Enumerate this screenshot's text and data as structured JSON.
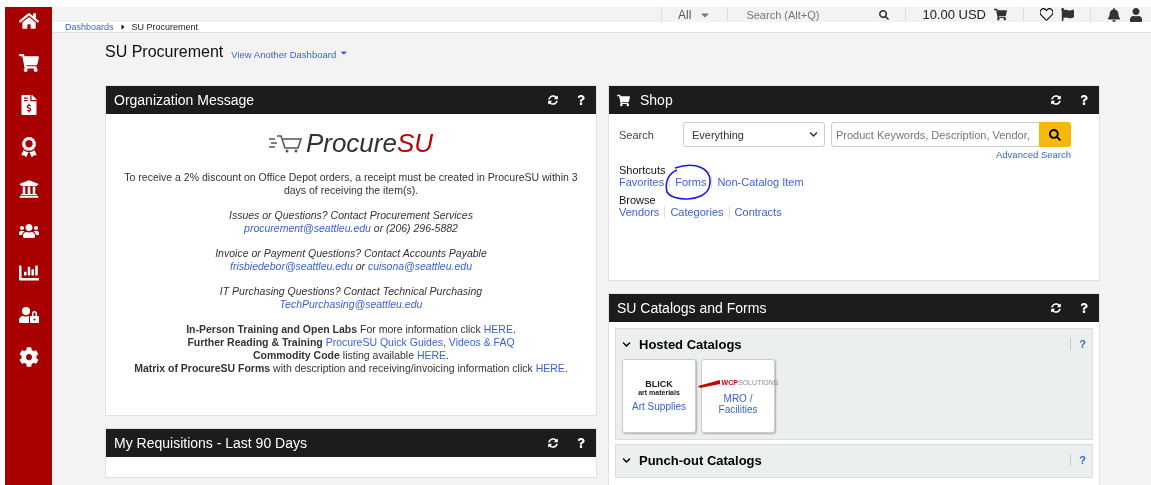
{
  "top_bar": {
    "scope": "All",
    "search_placeholder": "Search (Alt+Q)",
    "cart_total": "10.00 USD"
  },
  "sidebar": {
    "items": [
      {
        "kind": "home"
      },
      {
        "kind": "cart"
      },
      {
        "kind": "orders"
      },
      {
        "kind": "award"
      },
      {
        "kind": "bank"
      },
      {
        "kind": "users"
      },
      {
        "kind": "chart"
      },
      {
        "kind": "lock"
      },
      {
        "kind": "settings"
      }
    ]
  },
  "breadcrumb": [
    "Dashboards",
    "SU Procurement"
  ],
  "page": {
    "title": "SU Procurement",
    "switcher": "View Another Dashboard"
  },
  "organization_message": {
    "title": "Organization Message",
    "logo": {
      "main": "Procure",
      "accent": "SU"
    },
    "paragraphs": [
      [
        [
          {
            "kind": "plain",
            "text": "To receive a 2% discount on Office Depot orders, a receipt must be created in ProcureSU within 3 days of receiving the item(s)."
          }
        ]
      ],
      [
        [
          {
            "kind": "italic",
            "text": "Issues or Questions? Contact Procurement Services"
          }
        ],
        [
          {
            "kind": "link",
            "text": "procurement@seattleu.edu"
          },
          {
            "kind": "note",
            "text": " or (206) 296-5882"
          }
        ]
      ],
      [
        [
          {
            "kind": "italic",
            "text": "Invoice or Payment Questions? Contact Accounts Payable"
          }
        ],
        [
          {
            "kind": "link",
            "text": "frisbiedebor@seattleu.edu"
          },
          {
            "kind": "note",
            "text": " or "
          },
          {
            "kind": "link",
            "text": "cuisona@seattleu.edu"
          }
        ]
      ],
      [
        [
          {
            "kind": "italic",
            "text": "IT Purchasing Questions? Contact Technical Purchasing"
          }
        ],
        [
          {
            "kind": "link",
            "text": "TechPurchasing@seattleu.edu"
          }
        ]
      ],
      [
        [
          {
            "kind": "bold",
            "text": "In-Person Training and Open Labs"
          },
          {
            "kind": "plain",
            "text": " For more information click "
          },
          {
            "kind": "link",
            "text": "HERE"
          },
          {
            "kind": "plain",
            "text": "."
          }
        ],
        [
          {
            "kind": "bold",
            "text": "Further Reading & Training "
          },
          {
            "kind": "link",
            "text": "ProcureSU Quick Guides, Videos & FAQ"
          }
        ],
        [
          {
            "kind": "bold",
            "text": "Commodity Code"
          },
          {
            "kind": "plain",
            "text": " listing available "
          },
          {
            "kind": "link",
            "text": "HERE"
          },
          {
            "kind": "plain",
            "text": "."
          }
        ],
        [
          {
            "kind": "bold",
            "text": "Matrix of ProcureSU Forms"
          },
          {
            "kind": "plain",
            "text": " with description and receiving/invoicing information click "
          },
          {
            "kind": "link",
            "text": "HERE"
          },
          {
            "kind": "plain",
            "text": "."
          }
        ]
      ]
    ]
  },
  "requisitions": {
    "title": "My Requisitions - Last 90 Days"
  },
  "shop": {
    "title": "Shop",
    "search_label": "Search",
    "category": "Everything",
    "placeholder": "Product Keywords, Description, Vendor,",
    "advanced": "Advanced Search",
    "groups": [
      {
        "label": "Shortcuts",
        "links": [
          {
            "text": "Favorites",
            "circled": false
          },
          {
            "text": "Forms",
            "circled": true
          },
          {
            "text": "Non-Catalog Item",
            "circled": false
          }
        ]
      },
      {
        "label": "Browse",
        "links": [
          {
            "text": "Vendors",
            "circled": false
          },
          {
            "text": "Categories",
            "circled": false
          },
          {
            "text": "Contracts",
            "circled": false
          }
        ]
      }
    ]
  },
  "catalogs": {
    "title": "SU Catalogs and Forms",
    "sections": [
      {
        "title": "Hosted Catalogs",
        "expanded": true,
        "help": "?",
        "tiles": [
          {
            "kind": "blick",
            "logo": "BLICK",
            "logo_sub": "art materials",
            "label": "Art Supplies"
          },
          {
            "kind": "wcp",
            "logo": "WCP",
            "logo_sub": "SOLUTIONS",
            "label": "MRO / Facilities"
          }
        ]
      },
      {
        "title": "Punch-out Catalogs",
        "expanded": true,
        "help": "?"
      }
    ]
  }
}
